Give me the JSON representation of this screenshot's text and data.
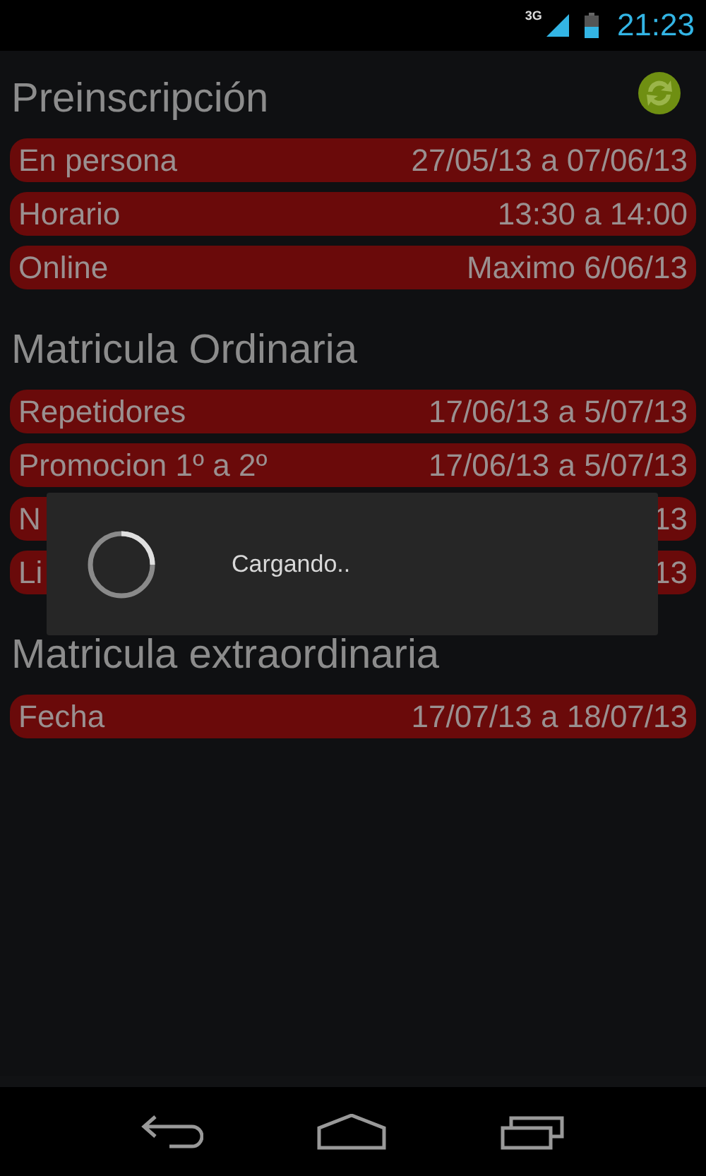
{
  "status_bar": {
    "network": "3G",
    "time": "21:23"
  },
  "sections": [
    {
      "title": "Preinscripción",
      "refresh_button": true,
      "rows": [
        {
          "label": "En persona",
          "value": "27/05/13 a 07/06/13"
        },
        {
          "label": "Horario",
          "value": "13:30 a 14:00"
        },
        {
          "label": "Online",
          "value": "Maximo 6/06/13"
        }
      ]
    },
    {
      "title": "Matricula Ordinaria",
      "rows": [
        {
          "label": "Repetidores",
          "value": "17/06/13 a 5/07/13"
        },
        {
          "label": "Promocion 1º a 2º",
          "value": "17/06/13 a 5/07/13"
        },
        {
          "label": "N",
          "value": "13"
        },
        {
          "label": "Li",
          "value": "13"
        }
      ]
    },
    {
      "title": "Matricula extraordinaria",
      "rows": [
        {
          "label": "Fecha",
          "value": "17/07/13 a 18/07/13"
        }
      ]
    }
  ],
  "dialog": {
    "message": "Cargando.."
  }
}
